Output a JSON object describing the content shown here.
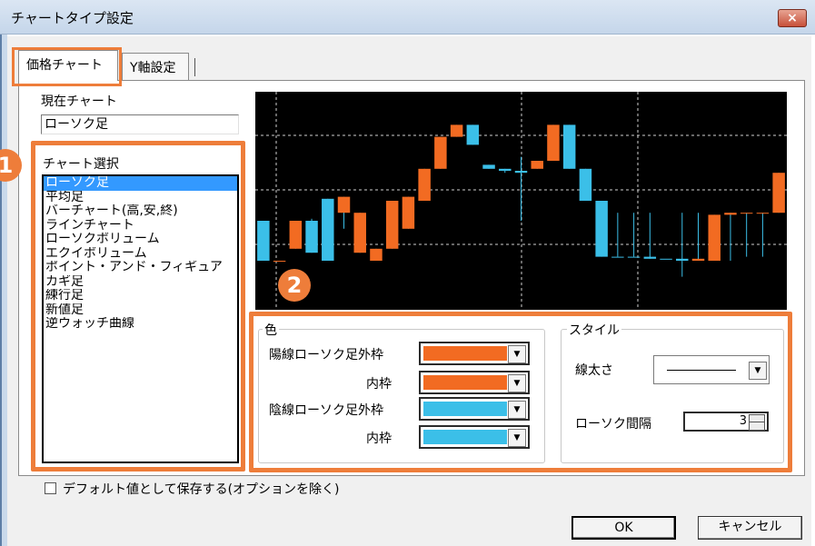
{
  "window": {
    "title": "チャートタイプ設定",
    "close_label": "×"
  },
  "tabs": [
    {
      "label": "価格チャート"
    },
    {
      "label": "Y軸設定"
    }
  ],
  "current_chart": {
    "label": "現在チャート",
    "value": "ローソク足"
  },
  "chart_select": {
    "label": "チャート選択",
    "items": [
      "ローソク足",
      "平均足",
      "バーチャート(高,安,終)",
      "ラインチャート",
      "ローソクボリューム",
      "エクイボリューム",
      "ポイント・アンド・フィギュア",
      "カギ足",
      "練行足",
      "新値足",
      "逆ウォッチ曲線"
    ],
    "selected_index": 0
  },
  "badges": {
    "one": "1",
    "two": "2"
  },
  "color_group": {
    "title": "色",
    "rows": [
      {
        "label": "陽線ローソク足外枠",
        "color": "#f26b22"
      },
      {
        "label": "内枠",
        "color": "#f26b22"
      },
      {
        "label": "陰線ローソク足外枠",
        "color": "#3bbfe8"
      },
      {
        "label": "内枠",
        "color": "#3bbfe8"
      }
    ]
  },
  "style_group": {
    "title": "スタイル",
    "line_width_label": "線太さ",
    "candle_gap_label": "ローソク間隔",
    "candle_gap_value": "3"
  },
  "save_default": {
    "label": "デフォルト値として保存する(オプションを除く)",
    "checked": false
  },
  "buttons": {
    "ok": "OK",
    "cancel": "キャンセル"
  },
  "colors": {
    "up": "#f26b22",
    "down": "#3bbfe8",
    "highlight": "#ee7d3a",
    "selection": "#3399ff"
  },
  "preview_candles": [
    {
      "dir": "down",
      "body": [
        4,
        2
      ],
      "wick": [
        4,
        2
      ]
    },
    {
      "dir": "up",
      "body": [
        2,
        2
      ],
      "wick": [
        2,
        2
      ]
    },
    {
      "dir": "up",
      "body": [
        2.6,
        4
      ],
      "wick": [
        2.6,
        4
      ]
    },
    {
      "dir": "down",
      "body": [
        2.4,
        4
      ],
      "wick": [
        2.4,
        4.1
      ]
    },
    {
      "dir": "down",
      "body": [
        2,
        5.1
      ],
      "wick": [
        2,
        5.1
      ]
    },
    {
      "dir": "up",
      "body": [
        4.4,
        5.2
      ],
      "wick": [
        3.6,
        5.2
      ]
    },
    {
      "dir": "up",
      "body": [
        4.4,
        2.4
      ],
      "wick": [
        4.4,
        2.4
      ]
    },
    {
      "dir": "up",
      "body": [
        2,
        2.6
      ],
      "wick": [
        2,
        2.6
      ]
    },
    {
      "dir": "up",
      "body": [
        2.6,
        5
      ],
      "wick": [
        2.6,
        5
      ]
    },
    {
      "dir": "up",
      "body": [
        3.6,
        5.2
      ],
      "wick": [
        3.6,
        5.2
      ]
    },
    {
      "dir": "up",
      "body": [
        5,
        6.6
      ],
      "wick": [
        5,
        6.6
      ]
    },
    {
      "dir": "up",
      "body": [
        6.6,
        8.2
      ],
      "wick": [
        6.6,
        8.2
      ]
    },
    {
      "dir": "up",
      "body": [
        8.2,
        8.8
      ],
      "wick": [
        8.2,
        8.8
      ]
    },
    {
      "dir": "down",
      "body": [
        8.8,
        7.8
      ],
      "wick": [
        8.8,
        7.8
      ]
    },
    {
      "dir": "down",
      "body": [
        6.8,
        6.6
      ],
      "wick": [
        6.8,
        6.6
      ]
    },
    {
      "dir": "down",
      "body": [
        6.6,
        6.5
      ],
      "wick": [
        6.6,
        6.4
      ]
    },
    {
      "dir": "down",
      "body": [
        6.5,
        6.4
      ],
      "wick": [
        7.2,
        4
      ]
    },
    {
      "dir": "up",
      "body": [
        6.6,
        7
      ],
      "wick": [
        6.6,
        7
      ]
    },
    {
      "dir": "up",
      "body": [
        7,
        8.8
      ],
      "wick": [
        7,
        8.8
      ]
    },
    {
      "dir": "down",
      "body": [
        8.8,
        6.6
      ],
      "wick": [
        8.8,
        6.6
      ]
    },
    {
      "dir": "down",
      "body": [
        6.6,
        5
      ],
      "wick": [
        6.6,
        5
      ]
    },
    {
      "dir": "down",
      "body": [
        5,
        2.2
      ],
      "wick": [
        5,
        2.2
      ]
    },
    {
      "dir": "down",
      "body": [
        2.2,
        2.2
      ],
      "wick": [
        4.4,
        2.2
      ]
    },
    {
      "dir": "down",
      "body": [
        2.2,
        2.2
      ],
      "wick": [
        4.4,
        2.2
      ]
    },
    {
      "dir": "down",
      "body": [
        2.2,
        2.1
      ],
      "wick": [
        4.4,
        2.1
      ]
    },
    {
      "dir": "down",
      "body": [
        2.1,
        2.1
      ],
      "wick": [
        2.1,
        2.1
      ]
    },
    {
      "dir": "down",
      "body": [
        2.1,
        2
      ],
      "wick": [
        4.4,
        1.2
      ]
    },
    {
      "dir": "up",
      "body": [
        2,
        2.1
      ],
      "wick": [
        2,
        4.4
      ]
    },
    {
      "dir": "up",
      "body": [
        2,
        4.3
      ],
      "wick": [
        2,
        4.3
      ]
    },
    {
      "dir": "up",
      "body": [
        4.3,
        4.4
      ],
      "wick": [
        2,
        4.4
      ]
    },
    {
      "dir": "up",
      "body": [
        4.4,
        4.4
      ],
      "wick": [
        2.2,
        4.4
      ]
    },
    {
      "dir": "up",
      "body": [
        4.4,
        4.4
      ],
      "wick": [
        2.2,
        4.4
      ]
    },
    {
      "dir": "up",
      "body": [
        4.4,
        6.4
      ],
      "wick": [
        4.4,
        6.4
      ]
    }
  ]
}
